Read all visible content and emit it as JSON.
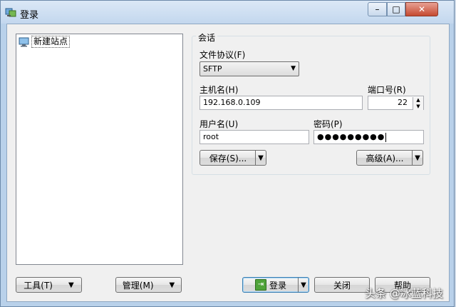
{
  "window": {
    "title": "登录",
    "icon": "winscp-icon",
    "min_symbol": "–",
    "max_symbol": "□",
    "close_symbol": "✕"
  },
  "sites": {
    "items": [
      {
        "label": "新建站点",
        "icon": "computer-icon"
      }
    ]
  },
  "session": {
    "legend": "会话",
    "protocol_label": "文件协议(F)",
    "protocol_value": "SFTP",
    "host_label": "主机名(H)",
    "host_value": "192.168.0.109",
    "port_label": "端口号(R)",
    "port_value": "22",
    "user_label": "用户名(U)",
    "user_value": "root",
    "password_label": "密码(P)",
    "password_value": "●●●●●●●●●",
    "save_button": "保存(S)...",
    "advanced_button": "高级(A)..."
  },
  "footer": {
    "tools_button": "工具(T)",
    "manage_button": "管理(M)",
    "login_button": "登录",
    "close_button": "关闭",
    "help_button": "帮助"
  },
  "watermark": {
    "text": "头条 @冰蓝科技"
  },
  "colors": {
    "title_bar": "#c3d7ee",
    "close_button": "#c54a31",
    "dialog_bg": "#f0f0f0",
    "login_icon": "#4fa33a"
  }
}
